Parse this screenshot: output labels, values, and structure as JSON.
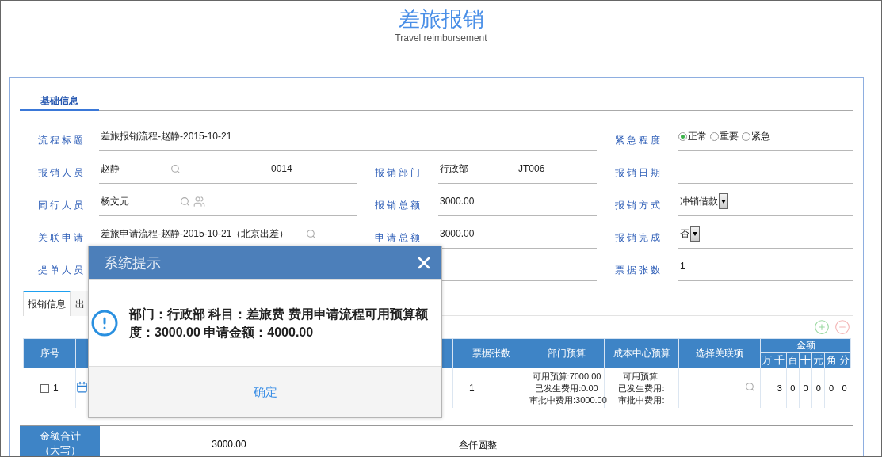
{
  "header": {
    "title": "差旅报销",
    "subtitle": "Travel reimbursement"
  },
  "section_tab": {
    "label": "基础信息",
    "selected": true
  },
  "form_rows": [
    {
      "cells": [
        {
          "label": "流程标题",
          "kind": "wide",
          "value": "差旅报销流程-赵静-2015-10-21"
        },
        {
          "label": "紧急程度",
          "kind": "radio",
          "options": [
            {
              "label": "正常",
              "selected": true
            },
            {
              "label": "重要",
              "selected": false
            },
            {
              "label": "紧急",
              "selected": false
            }
          ]
        }
      ]
    },
    {
      "cells": [
        {
          "label": "报销人员",
          "kind": "lookup",
          "value": "赵静",
          "code": "0014"
        },
        {
          "label": "报销部门",
          "kind": "text",
          "value": "行政部",
          "code": "JT006"
        },
        {
          "label": "报销日期",
          "kind": "text"
        }
      ]
    },
    {
      "cells": [
        {
          "label": "同行人员",
          "kind": "lookup_person",
          "value": "杨文元"
        },
        {
          "label": "报销总额",
          "kind": "text",
          "value": "3000.00"
        },
        {
          "label": "报销方式",
          "kind": "select",
          "value": "冲销借款"
        }
      ]
    },
    {
      "cells": [
        {
          "label": "关联申请",
          "kind": "lookup_long",
          "value": "差旅申请流程-赵静-2015-10-21（北京出差）"
        },
        {
          "label": "申请总额",
          "kind": "text",
          "value": "3000.00"
        },
        {
          "label": "报销完成",
          "kind": "select",
          "value": "否"
        }
      ]
    },
    {
      "cells": [
        {
          "label": "提单人员"
        },
        {
          "kind": "text"
        },
        {
          "label": "票据张数",
          "kind": "text",
          "value": "1"
        }
      ]
    }
  ],
  "detail_tabs": [
    {
      "label": "报销信息",
      "selected": true
    },
    {
      "label": "出",
      "selected": false
    }
  ],
  "table": {
    "columns": [
      {
        "label": "序号"
      },
      {
        "kind": "date"
      },
      {
        "label": "票据张数"
      },
      {
        "label": "部门预算"
      },
      {
        "label": "成本中心预算"
      },
      {
        "label": "选择关联项"
      },
      {
        "label": "金额",
        "units": [
          "万",
          "千",
          "百",
          "十",
          "元",
          "角",
          "分"
        ]
      }
    ],
    "rows": [
      {
        "checked": false,
        "index": "1",
        "tickets": "1",
        "dept_budget": [
          "可用预算:7000.00",
          "已发生费用:0.00",
          "审批中费用:3000.00"
        ],
        "cost_budget": [
          "可用预算:",
          "已发生费用:",
          "审批中费用:"
        ],
        "digits": [
          "3",
          "0",
          "0",
          "0",
          "0",
          "0"
        ]
      }
    ]
  },
  "total": {
    "label": "金额合计（大写）",
    "value": "3000.00",
    "in_words": "叁仟圆整"
  },
  "dialog": {
    "title": "系统提示",
    "message": "部门：行政部 科目：差旅费 费用申请流程可用预算额度：3000.00 申请金额：4000.00",
    "button": "确定"
  }
}
